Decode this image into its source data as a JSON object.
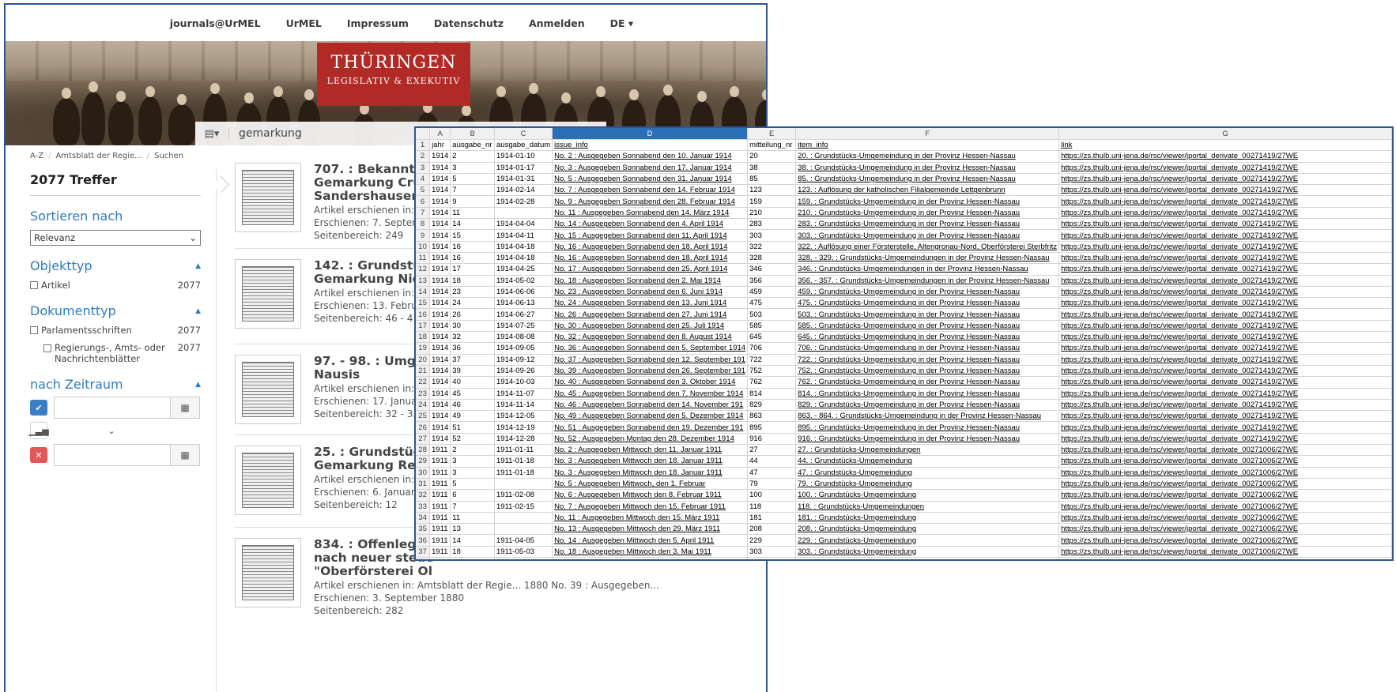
{
  "nav": {
    "items": [
      "journals@UrMEL",
      "UrMEL",
      "Impressum",
      "Datenschutz",
      "Anmelden",
      "DE ▾"
    ]
  },
  "banner": {
    "logo_line1": "THÜRINGEN",
    "logo_line2": "LEGISLATIV & EXEKUTIV"
  },
  "search": {
    "value": "gemarkung",
    "type_icon": "list-icon"
  },
  "breadcrumb": [
    "A-Z",
    "Amtsblatt der Regie...",
    "Suchen"
  ],
  "sidebar": {
    "hits": "2077 Treffer",
    "sort_title": "Sortieren nach",
    "sort_value": "Relevanz",
    "objekttyp_title": "Objekttyp",
    "objekttyp_items": [
      {
        "label": "Artikel",
        "count": "2077"
      }
    ],
    "dokumenttyp_title": "Dokumenttyp",
    "dokumenttyp_items": [
      {
        "label": "Parlamentsschriften",
        "count": "2077"
      },
      {
        "label": "Regierungs-, Amts- oder Nachrichtenblätter",
        "count": "2077"
      }
    ],
    "zeitraum_title": "nach Zeitraum"
  },
  "results": [
    {
      "title_lines": [
        "707. : Bekanntma",
        "Gemarkung Crum",
        "Sandershausen"
      ],
      "published_in": "Artikel erschienen in:",
      "date": "Erschienen:  7. Septem",
      "pages": "Seitenbereich:  249"
    },
    {
      "title_lines": [
        "142. : Grundstück",
        "Gemarkung Nied"
      ],
      "published_in": "Artikel erschienen in:",
      "date": "Erschienen:  13. Febru",
      "pages": "Seitenbereich:  46 - 47"
    },
    {
      "title_lines": [
        "97. - 98. : Umgem",
        "Nausis"
      ],
      "published_in": "Artikel erschienen in:",
      "date": "Erschienen:  17. Janua",
      "pages": "Seitenbereich:  32 - 33"
    },
    {
      "title_lines": [
        "25. : Grundstücks",
        "Gemarkung Reins"
      ],
      "published_in": "Artikel erschienen in:",
      "date": "Erschienen:  6. Januar",
      "pages": "Seitenbereich:  12"
    },
    {
      "title_lines": [
        "834. : Offenlegung",
        "nach neuer steue",
        "\"Oberförsterei Ol"
      ],
      "published_in": "Artikel erschienen in:  Amtsblatt der Regie...    1880    No. 39 : Ausgegeben...",
      "date": "Erschienen:  3. September 1880",
      "pages": "Seitenbereich:  282"
    }
  ],
  "sheet": {
    "columns": [
      "A",
      "B",
      "C",
      "D",
      "E",
      "F",
      "G"
    ],
    "header": [
      "jahr",
      "ausgabe_nr",
      "ausgabe_datum",
      "issue_info",
      "mitteilung_nr",
      "item_info",
      "link"
    ],
    "rows": [
      [
        "1914",
        "2",
        "1914-01-10",
        "No. 2 : Ausgegeben Sonnabend den 10. Januar 1914",
        "20",
        "20. : Grundstücks-Umgemeindung in der Provinz Hessen-Nassau",
        "https://zs.thulb.uni-jena.de/rsc/viewer/jportal_derivate_00271419/27WE"
      ],
      [
        "1914",
        "3",
        "1914-01-17",
        "No. 3 : Ausgegeben Sonnabend den 17. Januar 1914",
        "38",
        "38. : Grundstücks-Umgemeindung in der Provinz Hessen-Nassau",
        "https://zs.thulb.uni-jena.de/rsc/viewer/jportal_derivate_00271419/27WE"
      ],
      [
        "1914",
        "5",
        "1914-01-31",
        "No. 5 : Ausgegeben Sonnabend den 31. Januar 1914",
        "85",
        "85. : Grundstücks-Umgemeindung in der Provinz Hessen-Nassau",
        "https://zs.thulb.uni-jena.de/rsc/viewer/jportal_derivate_00271419/27WE"
      ],
      [
        "1914",
        "7",
        "1914-02-14",
        "No. 7 : Ausgegeben Sonnabend den 14. Februar 1914",
        "123",
        "123. : Auflösung der katholischen Filialgemeinde Lettgenbrunn",
        "https://zs.thulb.uni-jena.de/rsc/viewer/jportal_derivate_00271419/27WE"
      ],
      [
        "1914",
        "9",
        "1914-02-28",
        "No. 9 : Ausgegeben Sonnabend den 28. Februar 1914",
        "159",
        "159. : Grundstücks-Umgemeindung in der Provinz Hessen-Nassau",
        "https://zs.thulb.uni-jena.de/rsc/viewer/jportal_derivate_00271419/27WE"
      ],
      [
        "1914",
        "11",
        "",
        "No. 11 : Ausgegeben Sonnabend den 14. März 1914",
        "210",
        "210. : Grundstücks-Umgemeindung in der Provinz Hessen-Nassau",
        "https://zs.thulb.uni-jena.de/rsc/viewer/jportal_derivate_00271419/27WE"
      ],
      [
        "1914",
        "14",
        "1914-04-04",
        "No. 14 : Ausgegeben Sonnabend den 4. April 1914",
        "283",
        "283. : Grundstücks-Umgemeindung in der Provinz Hessen-Nassau",
        "https://zs.thulb.uni-jena.de/rsc/viewer/jportal_derivate_00271419/27WE"
      ],
      [
        "1914",
        "15",
        "1914-04-11",
        "No. 15 : Ausgegeben Sonnabend den 11. April 1914",
        "303",
        "303. : Grundstücks-Umgemeindung in der Provinz Hessen-Nassau",
        "https://zs.thulb.uni-jena.de/rsc/viewer/jportal_derivate_00271419/27WE"
      ],
      [
        "1914",
        "16",
        "1914-04-18",
        "No. 16 : Ausgegeben Sonnabend den 18. April 1914",
        "322",
        "322. : Auflösung einer Försterstelle, Altengronau-Nord, Oberförsterei Sterbfritz",
        "https://zs.thulb.uni-jena.de/rsc/viewer/jportal_derivate_00271419/27WE"
      ],
      [
        "1914",
        "16",
        "1914-04-18",
        "No. 16 : Ausgegeben Sonnabend den 18. April 1914",
        "328",
        "328. - 329. : Grundstücks-Umgemeindungen in der Provinz Hessen-Nassau",
        "https://zs.thulb.uni-jena.de/rsc/viewer/jportal_derivate_00271419/27WE"
      ],
      [
        "1914",
        "17",
        "1914-04-25",
        "No. 17 : Ausgegeben Sonnabend den 25. April 1914",
        "346",
        "346. : Grundstücks-Umgemeindungen in der Provinz Hessen-Nassau",
        "https://zs.thulb.uni-jena.de/rsc/viewer/jportal_derivate_00271419/27WE"
      ],
      [
        "1914",
        "18",
        "1914-05-02",
        "No. 18 : Ausgegeben Sonnabend den 2. Mai 1914",
        "356",
        "356. - 357. : Grundstücks-Umgemeindungen in der Provinz Hessen-Nassau",
        "https://zs.thulb.uni-jena.de/rsc/viewer/jportal_derivate_00271419/27WE"
      ],
      [
        "1914",
        "23",
        "1914-06-06",
        "No. 23 : Ausgegeben Sonnabend den 6. Juni 1914",
        "459",
        "459. : Grundstücks-Umgemeindung in der Provinz Hessen-Nassau",
        "https://zs.thulb.uni-jena.de/rsc/viewer/jportal_derivate_00271419/27WE"
      ],
      [
        "1914",
        "24",
        "1914-06-13",
        "No. 24 : Ausgegeben Sonnabend den 13. Juni 1914",
        "475",
        "475. : Grundstücks-Umgemeindung in der Provinz Hessen-Nassau",
        "https://zs.thulb.uni-jena.de/rsc/viewer/jportal_derivate_00271419/27WE"
      ],
      [
        "1914",
        "26",
        "1914-06-27",
        "No. 26 : Ausgegeben Sonnabend den 27. Juni 1914",
        "503",
        "503. : Grundstücks-Umgemeindung in der Provinz Hessen-Nassau",
        "https://zs.thulb.uni-jena.de/rsc/viewer/jportal_derivate_00271419/27WE"
      ],
      [
        "1914",
        "30",
        "1914-07-25",
        "No. 30 : Ausgegeben Sonnabend den 25. Juli 1914",
        "585",
        "585. : Grundstücks-Umgemeindung in der Provinz Hessen-Nassau",
        "https://zs.thulb.uni-jena.de/rsc/viewer/jportal_derivate_00271419/27WE"
      ],
      [
        "1914",
        "32",
        "1914-08-08",
        "No. 32 : Ausgegeben Sonnabend den 8. August 1914",
        "645",
        "645. : Grundstücks-Umgemeindung in der Provinz Hessen-Nassau",
        "https://zs.thulb.uni-jena.de/rsc/viewer/jportal_derivate_00271419/27WE"
      ],
      [
        "1914",
        "36",
        "1914-09-05",
        "No. 36 : Ausgegeben Sonnabend den 5. September 1914",
        "706",
        "706. : Grundstücks-Umgemeindung in der Provinz Hessen-Nassau",
        "https://zs.thulb.uni-jena.de/rsc/viewer/jportal_derivate_00271419/27WE"
      ],
      [
        "1914",
        "37",
        "1914-09-12",
        "No. 37 : Ausgegeben Sonnabend den 12. September 191",
        "722",
        "722. : Grundstücks-Umgemeindung in der Provinz Hessen-Nassau",
        "https://zs.thulb.uni-jena.de/rsc/viewer/jportal_derivate_00271419/27WE"
      ],
      [
        "1914",
        "39",
        "1914-09-26",
        "No. 39 : Ausgegeben Sonnabend den 26. September 191",
        "752",
        "752. : Grundstücks-Umgemeindung in der Provinz Hessen-Nassau",
        "https://zs.thulb.uni-jena.de/rsc/viewer/jportal_derivate_00271419/27WE"
      ],
      [
        "1914",
        "40",
        "1914-10-03",
        "No. 40 : Ausgegeben Sonnabend den 3. Oktober 1914",
        "762",
        "762. : Grundstücks-Umgemeindung in der Provinz Hessen-Nassau",
        "https://zs.thulb.uni-jena.de/rsc/viewer/jportal_derivate_00271419/27WE"
      ],
      [
        "1914",
        "45",
        "1914-11-07",
        "No. 45 : Ausgegeben Sonnabend den 7. November 1914",
        "814",
        "814. : Grundstücks-Umgemeindung in der Provinz Hessen-Nassau",
        "https://zs.thulb.uni-jena.de/rsc/viewer/jportal_derivate_00271419/27WE"
      ],
      [
        "1914",
        "46",
        "1914-11-14",
        "No. 46 : Ausgegeben Sonnabend den 14. November 191",
        "829",
        "829. : Grundstücks-Umgemeindung in der Provinz Hessen-Nassau",
        "https://zs.thulb.uni-jena.de/rsc/viewer/jportal_derivate_00271419/27WE"
      ],
      [
        "1914",
        "49",
        "1914-12-05",
        "No. 49 : Ausgegeben Sonnabend den 5. Dezember 1914",
        "863",
        "863. - 864. : Grundstücks-Umgemeindung in der Provinz Hessen-Nassau",
        "https://zs.thulb.uni-jena.de/rsc/viewer/jportal_derivate_00271419/27WE"
      ],
      [
        "1914",
        "51",
        "1914-12-19",
        "No. 51 : Ausgegeben Sonnabend den 19. Dezember 191",
        "895",
        "895. : Grundstücks-Umgemeindung in der Provinz Hessen-Nassau",
        "https://zs.thulb.uni-jena.de/rsc/viewer/jportal_derivate_00271419/27WE"
      ],
      [
        "1914",
        "52",
        "1914-12-28",
        "No. 52 : Ausgegeben Montag den 28. Dezember 1914",
        "916",
        "916. : Grundstücks-Umgemeindung in der Provinz Hessen-Nassau",
        "https://zs.thulb.uni-jena.de/rsc/viewer/jportal_derivate_00271419/27WE"
      ],
      [
        "1911",
        "2",
        "1911-01-11",
        "No. 2 : Ausgegeben Mittwoch den 11. Januar 1911",
        "27",
        "27. : Grundstücks-Umgemeindungen",
        "https://zs.thulb.uni-jena.de/rsc/viewer/jportal_derivate_00271006/27WE"
      ],
      [
        "1911",
        "3",
        "1911-01-18",
        "No. 3 : Ausgegeben Mittwoch den 18. Januar 1911",
        "44",
        "44. : Grundstücks-Umgemeindung",
        "https://zs.thulb.uni-jena.de/rsc/viewer/jportal_derivate_00271006/27WE"
      ],
      [
        "1911",
        "3",
        "1911-01-18",
        "No. 3 : Ausgegeben Mittwoch den 18. Januar 1911",
        "47",
        "47. : Grundstücks-Umgemeindung",
        "https://zs.thulb.uni-jena.de/rsc/viewer/jportal_derivate_00271006/27WE"
      ],
      [
        "1911",
        "5",
        "",
        "No. 5 : Ausgegeben Mittwoch, den 1. Februar",
        "79",
        "79. : Grundstücks-Umgemeindung",
        "https://zs.thulb.uni-jena.de/rsc/viewer/jportal_derivate_00271006/27WE"
      ],
      [
        "1911",
        "6",
        "1911-02-08",
        "No. 6 : Ausgegeben Mittwoch den 8. Februar 1911",
        "100",
        "100. : Grundstücks-Umgemeindung",
        "https://zs.thulb.uni-jena.de/rsc/viewer/jportal_derivate_00271006/27WE"
      ],
      [
        "1911",
        "7",
        "1911-02-15",
        "No. 7 : Ausgegeben Mittwoch den 15. Februar 1911",
        "118",
        "118. : Grundstücks-Umgemeindungen",
        "https://zs.thulb.uni-jena.de/rsc/viewer/jportal_derivate_00271006/27WE"
      ],
      [
        "1911",
        "11",
        "",
        "No. 11 : Ausgegeben Mittwoch den 15. März 1911",
        "181",
        "181. : Grundstücks-Umgemeindung",
        "https://zs.thulb.uni-jena.de/rsc/viewer/jportal_derivate_00271006/27WE"
      ],
      [
        "1911",
        "13",
        "",
        "No. 13 : Ausgegeben Mittwoch den 29. März 1911",
        "208",
        "208. : Grundstücks-Umgemeindung",
        "https://zs.thulb.uni-jena.de/rsc/viewer/jportal_derivate_00271006/27WE"
      ],
      [
        "1911",
        "14",
        "1911-04-05",
        "No. 14 : Ausgegeben Mittwoch den 5. April 1911",
        "229",
        "229. : Grundstücks-Umgemeindung",
        "https://zs.thulb.uni-jena.de/rsc/viewer/jportal_derivate_00271006/27WE"
      ],
      [
        "1911",
        "18",
        "1911-05-03",
        "No. 18 : Ausgegeben Mittwoch den 3. Mai 1911",
        "303",
        "303. : Grundstücks-Umgemeindung",
        "https://zs.thulb.uni-jena.de/rsc/viewer/jportal_derivate_00271006/27WE"
      ],
      [
        "1911",
        "25",
        "1911-06-21",
        "No. 25 : Ausgegeben Mittwoch den 21. Juni 1911",
        "451",
        "451. - 452. : Grundstücksumgemeindungen",
        "https://zs.thulb.uni-jena.de/rsc/viewer/jportal_derivate_00271006/27WE"
      ],
      [
        "1911",
        "27",
        "1911-07-05",
        "No. 27 : Ausgegeben Mittwoch den 5. Juli 1911",
        "496",
        "496. : Grundstücksumgemeindung im Kreise Ziegenhain",
        "https://zs.thulb.uni-jena.de/rsc/viewer/jportal_derivate_00271006/27WE"
      ]
    ]
  }
}
